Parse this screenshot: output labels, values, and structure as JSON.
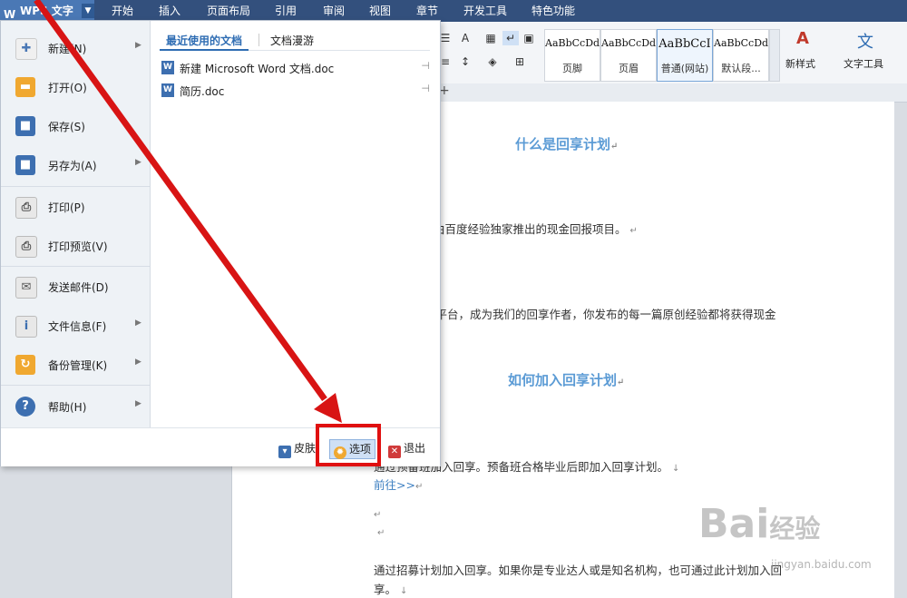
{
  "menubar": {
    "app_logo": "W",
    "app_name": "WPS 文字",
    "app_dropdown": "▼",
    "tabs": [
      "开始",
      "插入",
      "页面布局",
      "引用",
      "审阅",
      "视图",
      "章节",
      "开发工具",
      "特色功能"
    ]
  },
  "ribbon": {
    "styles": [
      {
        "sample": "AaBbCcDd",
        "label": "页脚"
      },
      {
        "sample": "AaBbCcDd",
        "label": "页眉"
      },
      {
        "sample": "AaBbCcI",
        "label": "普通(网站)"
      },
      {
        "sample": "AaBbCcDd",
        "label": "默认段..."
      }
    ],
    "new_style_label": "新样式",
    "text_tools_label": "文字工具"
  },
  "file_menu": {
    "items": [
      {
        "label": "新建(N)",
        "icon": "new-document-icon",
        "has_submenu": true
      },
      {
        "label": "打开(O)",
        "icon": "open-folder-icon",
        "has_submenu": false
      },
      {
        "label": "保存(S)",
        "icon": "save-icon",
        "has_submenu": false
      },
      {
        "label": "另存为(A)",
        "icon": "save-as-icon",
        "has_submenu": true
      },
      {
        "label": "打印(P)",
        "icon": "print-icon",
        "has_submenu": false
      },
      {
        "label": "打印预览(V)",
        "icon": "print-preview-icon",
        "has_submenu": false
      },
      {
        "label": "发送邮件(D)",
        "icon": "mail-icon",
        "has_submenu": false
      },
      {
        "label": "文件信息(F)",
        "icon": "file-info-icon",
        "has_submenu": true
      },
      {
        "label": "备份管理(K)",
        "icon": "backup-icon",
        "has_submenu": true
      },
      {
        "label": "帮助(H)",
        "icon": "help-icon",
        "has_submenu": true
      }
    ],
    "tabs": {
      "recent": "最近使用的文档",
      "roaming": "文档漫游"
    },
    "recent_files": [
      {
        "name": "新建 Microsoft Word 文档.doc"
      },
      {
        "name": "简历.doc"
      }
    ],
    "bottom": {
      "skin": "皮肤",
      "options": "选项",
      "exit": "退出"
    }
  },
  "document": {
    "heading1": "什么是回享计划",
    "line1": "由百度经验独家推出的现金回报项目。",
    "line2": "验平台，成为我们的回享作者，你发布的每一篇原创经验都将获得现金",
    "heading2": "如何加入回享计划",
    "line3": "通过预备班加入回享。预备班合格毕业后即加入回享计划。",
    "link": "前往>>",
    "line4": "通过招募计划加入回享。如果你是专业达人或是知名机构，也可通过此计划加入回",
    "line5": "享。"
  },
  "watermark": {
    "brand": "Bai",
    "brand2": "经验",
    "url": "jingyan.baidu.com"
  },
  "colors": {
    "menubar": "#33507d",
    "app_button": "#4a78b5",
    "heading": "#5b9bd5",
    "highlight": "#e01010",
    "arrow": "#d81414"
  }
}
